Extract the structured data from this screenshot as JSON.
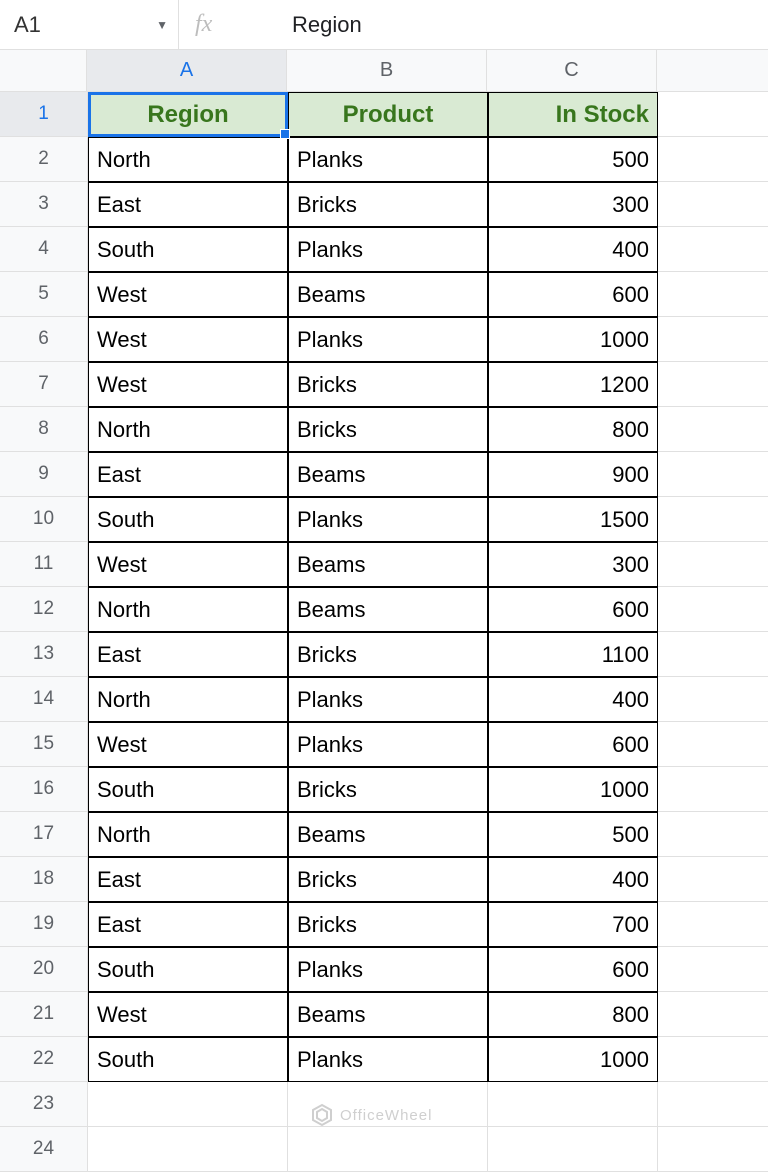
{
  "name_box": {
    "value": "A1"
  },
  "formula_bar": {
    "fx_label": "fx",
    "value": "Region"
  },
  "columns": [
    "A",
    "B",
    "C"
  ],
  "selected_column": "A",
  "selected_row": 1,
  "active_cell": "A1",
  "headers": {
    "region": "Region",
    "product": "Product",
    "in_stock": "In Stock"
  },
  "rows": [
    {
      "n": 2,
      "region": "North",
      "product": "Planks",
      "stock": "500"
    },
    {
      "n": 3,
      "region": "East",
      "product": "Bricks",
      "stock": "300"
    },
    {
      "n": 4,
      "region": "South",
      "product": "Planks",
      "stock": "400"
    },
    {
      "n": 5,
      "region": "West",
      "product": "Beams",
      "stock": "600"
    },
    {
      "n": 6,
      "region": "West",
      "product": "Planks",
      "stock": "1000"
    },
    {
      "n": 7,
      "region": "West",
      "product": "Bricks",
      "stock": "1200"
    },
    {
      "n": 8,
      "region": "North",
      "product": "Bricks",
      "stock": "800"
    },
    {
      "n": 9,
      "region": "East",
      "product": "Beams",
      "stock": "900"
    },
    {
      "n": 10,
      "region": "South",
      "product": "Planks",
      "stock": "1500"
    },
    {
      "n": 11,
      "region": "West",
      "product": "Beams",
      "stock": "300"
    },
    {
      "n": 12,
      "region": "North",
      "product": "Beams",
      "stock": "600"
    },
    {
      "n": 13,
      "region": "East",
      "product": "Bricks",
      "stock": "1100"
    },
    {
      "n": 14,
      "region": "North",
      "product": "Planks",
      "stock": "400"
    },
    {
      "n": 15,
      "region": "West",
      "product": "Planks",
      "stock": "600"
    },
    {
      "n": 16,
      "region": "South",
      "product": "Bricks",
      "stock": "1000"
    },
    {
      "n": 17,
      "region": "North",
      "product": "Beams",
      "stock": "500"
    },
    {
      "n": 18,
      "region": "East",
      "product": "Bricks",
      "stock": "400"
    },
    {
      "n": 19,
      "region": "East",
      "product": "Bricks",
      "stock": "700"
    },
    {
      "n": 20,
      "region": "South",
      "product": "Planks",
      "stock": "600"
    },
    {
      "n": 21,
      "region": "West",
      "product": "Beams",
      "stock": "800"
    },
    {
      "n": 22,
      "region": "South",
      "product": "Planks",
      "stock": "1000"
    }
  ],
  "extra_rows": [
    23,
    24
  ],
  "watermark": "OfficeWheel"
}
